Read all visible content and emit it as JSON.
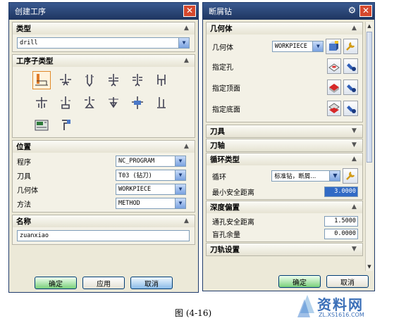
{
  "dialog1": {
    "title": "创建工序",
    "sections": {
      "type": {
        "header": "类型",
        "value": "drill"
      },
      "subtype": {
        "header": "工序子类型"
      },
      "location": {
        "header": "位置",
        "rows": [
          {
            "label": "程序",
            "value": "NC_PROGRAM"
          },
          {
            "label": "刀具",
            "value": "T03 (钻刀)"
          },
          {
            "label": "几何体",
            "value": "WORKPIECE"
          },
          {
            "label": "方法",
            "value": "METHOD"
          }
        ]
      },
      "name": {
        "header": "名称",
        "value": "zuanxiao"
      }
    },
    "buttons": {
      "ok": "确定",
      "apply": "应用",
      "cancel": "取消"
    }
  },
  "dialog2": {
    "title": "断屑钻",
    "geometry": {
      "header": "几何体",
      "geometry_label": "几何体",
      "geometry_value": "WORKPIECE",
      "hole_label": "指定孔",
      "top_label": "指定顶面",
      "bottom_label": "指定底面"
    },
    "collapsed": {
      "tool": "刀具",
      "axis": "刀轴"
    },
    "cycle": {
      "header": "循环类型",
      "cycle_label": "循环",
      "cycle_value": "标准钻，断屑...",
      "clearance_label": "最小安全距离",
      "clearance_value": "3.0000"
    },
    "depth": {
      "header": "深度偏置",
      "through_label": "通孔安全距离",
      "through_value": "1.5000",
      "blind_label": "盲孔余量",
      "blind_value": "0.0000"
    },
    "toolpath": {
      "header": "刀轨设置"
    },
    "buttons": {
      "ok": "确定",
      "cancel": "取消"
    }
  },
  "caption": "图 (4-16)",
  "watermark": {
    "main": "资料网",
    "url": "ZL.XS1616.COM"
  }
}
